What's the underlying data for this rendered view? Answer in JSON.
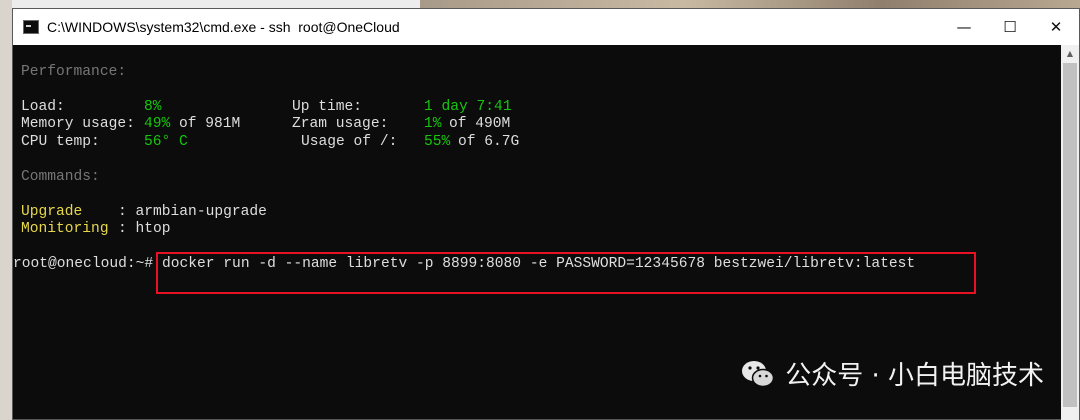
{
  "window": {
    "title": "C:\\WINDOWS\\system32\\cmd.exe - ssh  root@OneCloud",
    "minimize_label": "—",
    "maximize_label": "☐",
    "close_label": "✕"
  },
  "terminal": {
    "performance_header": "Performance:",
    "load_label": "Load:",
    "load_value": "8%",
    "uptime_label": "Up time:",
    "uptime_value": "1 day 7:41",
    "memory_label": "Memory usage:",
    "memory_value": "49%",
    "memory_of": "of 981M",
    "zram_label": "Zram usage:",
    "zram_value": "1%",
    "zram_of": "of 490M",
    "cpu_label": "CPU temp:",
    "cpu_value": "56° C",
    "disk_label": "Usage of /:",
    "disk_value": "55%",
    "disk_of": "of 6.7G",
    "commands_header": "Commands:",
    "upgrade_label": "Upgrade",
    "upgrade_cmd": ": armbian-upgrade",
    "monitoring_label": "Monitoring",
    "monitoring_cmd": ": htop",
    "prompt": "root@onecloud:~#",
    "command": "docker run -d --name libretv -p 8899:8080 -e PASSWORD=12345678 bestzwei/libretv:latest"
  },
  "watermark": {
    "text": "公众号 · 小白电脑技术"
  },
  "colors": {
    "terminal_bg": "#0c0c0c",
    "green": "#16c60c",
    "yellow": "#e6d84a",
    "grey": "#767676",
    "highlight": "#e81123"
  }
}
